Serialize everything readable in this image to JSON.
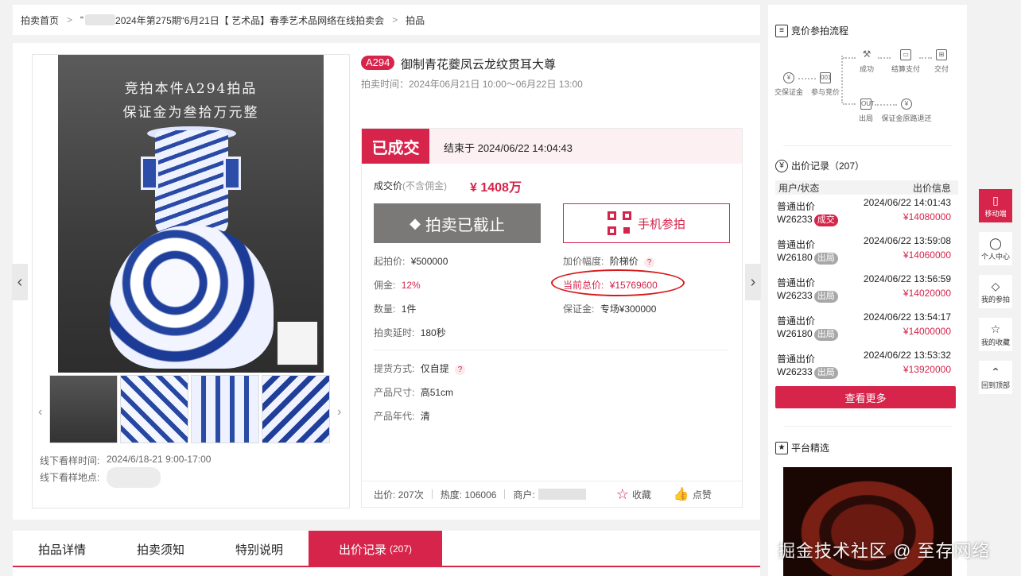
{
  "breadcrumb": {
    "home": "拍卖首页",
    "sep": ">",
    "fragment": "“",
    "session": "2024年第275期“6月21日【 艺术品】春季艺术品网络在线拍卖会",
    "current": "拍品"
  },
  "lot": {
    "code": "A294",
    "title": "御制青花夔凤云龙纹贯耳大尊",
    "auction_time": "拍卖时间：2024年06月21日 10:00～06月22日 13:00",
    "image_caption_1": "竞拍本件A294拍品",
    "image_caption_2": "保证金为叁拾万元整",
    "viewing_time_label": "线下看样时间:",
    "viewing_time": "2024/6/18-21 9:00-17:00",
    "viewing_place_label": "线下看样地点:"
  },
  "status": {
    "tag": "已成交",
    "end_time": "结束于 2024/06/22 14:04:43",
    "deal_label": "成交价",
    "deal_note": "(不含佣金)",
    "deal_price": "¥ 1408万",
    "btn_ended": "拍卖已截止",
    "btn_mobile": "手机参拍"
  },
  "details": {
    "start_price_label": "起拍价:",
    "start_price": "¥500000",
    "increment_label": "加价幅度:",
    "increment": "阶梯价",
    "commission_label": "佣金:",
    "commission": "12%",
    "current_total_label": "当前总价:",
    "current_total": "¥15769600",
    "quantity_label": "数量:",
    "quantity": "1件",
    "deposit_label": "保证金:",
    "deposit": "专场¥300000",
    "delay_label": "拍卖延时:",
    "delay": "180秒",
    "pickup_label": "提货方式:",
    "pickup": "仅自提",
    "size_label": "产品尺寸:",
    "size": "高51cm",
    "era_label": "产品年代:",
    "era": "清",
    "qmark": "?"
  },
  "stats": {
    "bids": "出价: 207次",
    "heat": "热度: 106006",
    "merchant": "商户:",
    "favorite": "收藏",
    "like": "点赞"
  },
  "tabs": [
    {
      "label": "拍品详情"
    },
    {
      "label": "拍卖须知"
    },
    {
      "label": "特别说明"
    },
    {
      "label": "出价记录",
      "count": "(207)"
    }
  ],
  "flow": {
    "title": "竞价参拍流程",
    "steps": {
      "deposit": "交保证金",
      "bid": "参与竞价",
      "success": "成功",
      "pay": "结算支付",
      "deliver": "交付",
      "out": "出局",
      "refund": "保证金原路退还"
    }
  },
  "bid_records": {
    "title": "出价记录（207）",
    "col_user": "用户/状态",
    "col_info": "出价信息",
    "rows": [
      {
        "type": "普通出价",
        "user": "W26233",
        "status": "成交",
        "time": "2024/06/22 14:01:43",
        "price": "¥14080000"
      },
      {
        "type": "普通出价",
        "user": "W26180",
        "status": "出局",
        "time": "2024/06/22 13:59:08",
        "price": "¥14060000"
      },
      {
        "type": "普通出价",
        "user": "W26233",
        "status": "出局",
        "time": "2024/06/22 13:56:59",
        "price": "¥14020000"
      },
      {
        "type": "普通出价",
        "user": "W26180",
        "status": "出局",
        "time": "2024/06/22 13:54:17",
        "price": "¥14000000"
      },
      {
        "type": "普通出价",
        "user": "W26233",
        "status": "出局",
        "time": "2024/06/22 13:53:32",
        "price": "¥13920000"
      }
    ],
    "more": "查看更多"
  },
  "featured": {
    "title": "平台精选"
  },
  "side_toolbar": [
    {
      "label": "移动端",
      "icon": "phone-icon"
    },
    {
      "label": "个人中心",
      "icon": "user-icon"
    },
    {
      "label": "我的参拍",
      "icon": "gavel-icon"
    },
    {
      "label": "我的收藏",
      "icon": "star-icon"
    },
    {
      "label": "回到顶部",
      "icon": "top-icon"
    }
  ],
  "watermark": "掘金技术社区 @ 至存网络",
  "colors": {
    "accent": "#d6244b",
    "ended_button": "#7b7878"
  }
}
